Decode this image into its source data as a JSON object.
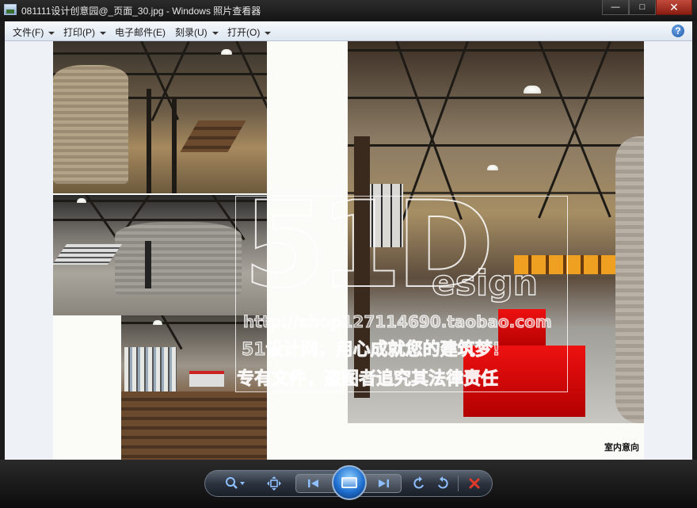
{
  "window": {
    "title": "081111设计创意园@_页面_30.jpg - Windows 照片查看器",
    "minimize": "—",
    "maximize": "□",
    "close": "✕"
  },
  "menu": {
    "items": [
      {
        "label": "文件(F)"
      },
      {
        "label": "打印(P)"
      },
      {
        "label": "电子邮件(E)"
      },
      {
        "label": "刻录(U)"
      },
      {
        "label": "打开(O)"
      }
    ],
    "help": "?"
  },
  "image": {
    "caption": "室内意向",
    "watermark": {
      "logo_main": "51",
      "logo_d": "D",
      "logo_design": "esign",
      "url": "http://shop127114690.taobao.com",
      "line1": "51设计网，用心成就您的建筑梦!",
      "line2": "专有文件，盗图者追究其法律责任"
    }
  },
  "controls": {
    "zoom_icon": "magnifier-icon",
    "fit_icon": "actual-size-icon",
    "prev_icon": "previous-icon",
    "slideshow_icon": "slideshow-icon",
    "next_icon": "next-icon",
    "rotate_ccw_icon": "rotate-counterclockwise-icon",
    "rotate_cw_icon": "rotate-clockwise-icon",
    "delete_icon": "delete-icon",
    "delete_color": "#e23a2a",
    "accent_color": "#8ec0ff"
  }
}
